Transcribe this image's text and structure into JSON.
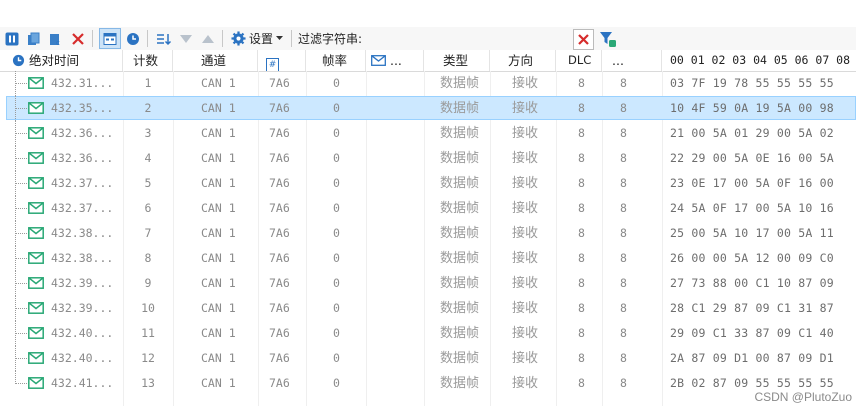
{
  "toolbar": {
    "settings_label": "设置",
    "filter_label": "过滤字符串:",
    "filter_value": ""
  },
  "columns": {
    "time": "绝对时间",
    "count": "计数",
    "channel": "通道",
    "id_icon": "#",
    "rate": "帧率",
    "msg_more": "...",
    "type": "类型",
    "direction": "方向",
    "dlc": "DLC",
    "more": "...",
    "bytes": "00 01 02 03 04 05 06 07 08"
  },
  "rows": [
    {
      "time": "432.31...",
      "count": "1",
      "channel": "CAN 1",
      "id": "7A6",
      "rate": "0",
      "type": "数据帧",
      "dir": "接收",
      "dlc": "8",
      "len": "8",
      "data": "03 7F 19 78 55 55 55 55"
    },
    {
      "time": "432.35...",
      "count": "2",
      "channel": "CAN 1",
      "id": "7A6",
      "rate": "0",
      "type": "数据帧",
      "dir": "接收",
      "dlc": "8",
      "len": "8",
      "data": "10 4F 59 0A 19 5A 00 98"
    },
    {
      "time": "432.36...",
      "count": "3",
      "channel": "CAN 1",
      "id": "7A6",
      "rate": "0",
      "type": "数据帧",
      "dir": "接收",
      "dlc": "8",
      "len": "8",
      "data": "21 00 5A 01 29 00 5A 02"
    },
    {
      "time": "432.36...",
      "count": "4",
      "channel": "CAN 1",
      "id": "7A6",
      "rate": "0",
      "type": "数据帧",
      "dir": "接收",
      "dlc": "8",
      "len": "8",
      "data": "22 29 00 5A 0E 16 00 5A"
    },
    {
      "time": "432.37...",
      "count": "5",
      "channel": "CAN 1",
      "id": "7A6",
      "rate": "0",
      "type": "数据帧",
      "dir": "接收",
      "dlc": "8",
      "len": "8",
      "data": "23 0E 17 00 5A 0F 16 00"
    },
    {
      "time": "432.37...",
      "count": "6",
      "channel": "CAN 1",
      "id": "7A6",
      "rate": "0",
      "type": "数据帧",
      "dir": "接收",
      "dlc": "8",
      "len": "8",
      "data": "24 5A 0F 17 00 5A 10 16"
    },
    {
      "time": "432.38...",
      "count": "7",
      "channel": "CAN 1",
      "id": "7A6",
      "rate": "0",
      "type": "数据帧",
      "dir": "接收",
      "dlc": "8",
      "len": "8",
      "data": "25 00 5A 10 17 00 5A 11"
    },
    {
      "time": "432.38...",
      "count": "8",
      "channel": "CAN 1",
      "id": "7A6",
      "rate": "0",
      "type": "数据帧",
      "dir": "接收",
      "dlc": "8",
      "len": "8",
      "data": "26 00 00 5A 12 00 09 C0"
    },
    {
      "time": "432.39...",
      "count": "9",
      "channel": "CAN 1",
      "id": "7A6",
      "rate": "0",
      "type": "数据帧",
      "dir": "接收",
      "dlc": "8",
      "len": "8",
      "data": "27 73 88 00 C1 10 87 09"
    },
    {
      "time": "432.39...",
      "count": "10",
      "channel": "CAN 1",
      "id": "7A6",
      "rate": "0",
      "type": "数据帧",
      "dir": "接收",
      "dlc": "8",
      "len": "8",
      "data": "28 C1 29 87 09 C1 31 87"
    },
    {
      "time": "432.40...",
      "count": "11",
      "channel": "CAN 1",
      "id": "7A6",
      "rate": "0",
      "type": "数据帧",
      "dir": "接收",
      "dlc": "8",
      "len": "8",
      "data": "29 09 C1 33 87 09 C1 40"
    },
    {
      "time": "432.40...",
      "count": "12",
      "channel": "CAN 1",
      "id": "7A6",
      "rate": "0",
      "type": "数据帧",
      "dir": "接收",
      "dlc": "8",
      "len": "8",
      "data": "2A 87 09 D1 00 87 09 D1"
    },
    {
      "time": "432.41...",
      "count": "13",
      "channel": "CAN 1",
      "id": "7A6",
      "rate": "0",
      "type": "数据帧",
      "dir": "接收",
      "dlc": "8",
      "len": "8",
      "data": "2B 02 87 09 55 55 55 55"
    }
  ],
  "selected_row": 1,
  "watermark": "CSDN @PlutoZuo",
  "colors": {
    "accent": "#1e6fb8",
    "selection": "#cce8ff",
    "message_icon": "#2aa876",
    "clear_red": "#d62b2b"
  }
}
